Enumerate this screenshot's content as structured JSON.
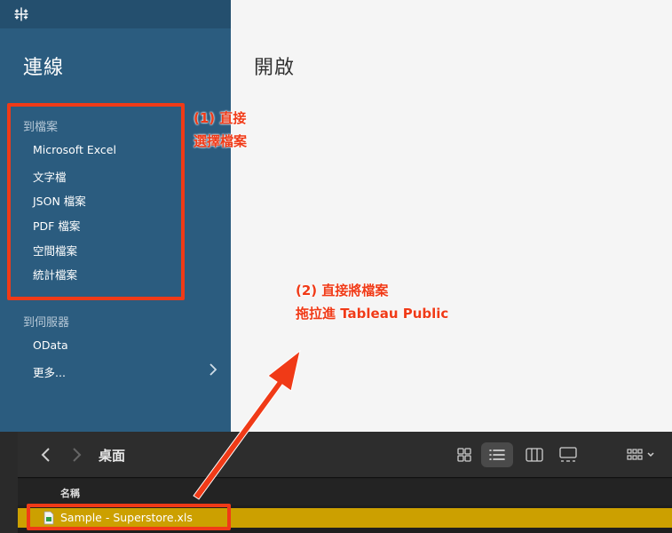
{
  "sidebar": {
    "title": "連線",
    "file_section_label": "到檔案",
    "file_items": [
      "Microsoft Excel",
      "文字檔",
      "JSON 檔案",
      "PDF 檔案",
      "空間檔案",
      "統計檔案"
    ],
    "server_section_label": "到伺服器",
    "server_items": [
      "OData",
      "更多..."
    ]
  },
  "main": {
    "title": "開啟"
  },
  "annotations": {
    "note1_line1": "(1) 直接",
    "note1_line2": "選擇檔案",
    "note2_line1": "(2) 直接將檔案",
    "note2_line2": "拖拉進 Tableau Public",
    "color": "#f03a17"
  },
  "finder": {
    "folder_title": "桌面",
    "column_name": "名稱",
    "file_name": "Sample - Superstore.xls",
    "selected_color": "#cca000"
  },
  "icons": {
    "logo": "tableau-logo-icon",
    "more_chevron": "chevron-right-icon",
    "back": "chevron-left-icon",
    "forward": "chevron-right-icon",
    "grid_view": "grid-view-icon",
    "list_view": "list-view-icon",
    "column_view": "column-view-icon",
    "gallery_view": "gallery-view-icon",
    "group": "group-options-icon",
    "file": "spreadsheet-file-icon"
  }
}
